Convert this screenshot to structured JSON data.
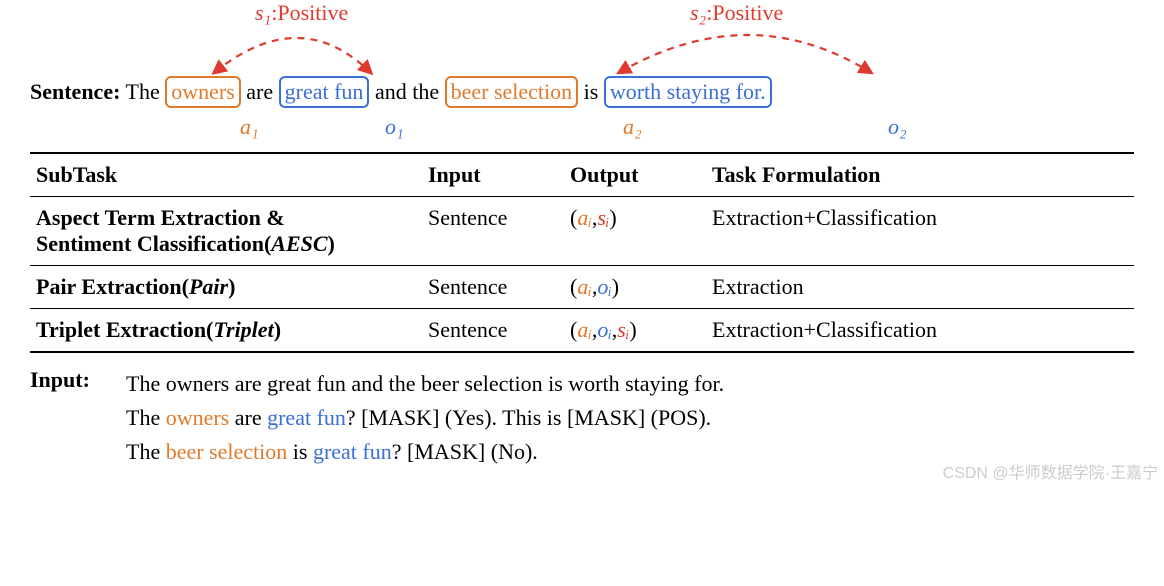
{
  "arc_labels": {
    "s1": "s₁",
    "s2": "s₂",
    "positive": ":Positive"
  },
  "sentence": {
    "label": "Sentence:",
    "w_the1": "The",
    "owners": "owners",
    "w_are": "are",
    "great_fun": "great fun",
    "w_and_the": "and the",
    "beer_selection": "beer selection",
    "w_is": "is",
    "worth_staying": "worth staying for.",
    "a1": "a₁",
    "o1": "o₁",
    "a2": "a₂",
    "o2": "o₂"
  },
  "table": {
    "headers": {
      "subtask": "SubTask",
      "input": "Input",
      "output": "Output",
      "formulation": "Task Formulation"
    },
    "rows": [
      {
        "subtask_prefix": "Aspect Term Extraction &",
        "subtask_break": " Sentiment Classification(",
        "subtask_em": "AESC",
        "subtask_suffix": ")",
        "input": "Sentence",
        "output_a": "aᵢ",
        "output_o": "",
        "output_s": "sᵢ",
        "formulation": "Extraction+Classification"
      },
      {
        "subtask_prefix": "Pair Extraction(",
        "subtask_break": "",
        "subtask_em": "Pair",
        "subtask_suffix": ")",
        "input": "Sentence",
        "output_a": "aᵢ",
        "output_o": "oᵢ",
        "output_s": "",
        "formulation": "Extraction"
      },
      {
        "subtask_prefix": "Triplet Extraction(",
        "subtask_break": "",
        "subtask_em": "Triplet",
        "subtask_suffix": ")",
        "input": "Sentence",
        "output_a": "aᵢ",
        "output_o": "oᵢ",
        "output_s": "sᵢ",
        "formulation": "Extraction+Classification"
      }
    ]
  },
  "input_block": {
    "label": "Input:",
    "line1": "The owners are great fun and the beer selection is worth staying for.",
    "l2_a": "The ",
    "l2_owners": "owners",
    "l2_b": " are ",
    "l2_greatfun": "great fun",
    "l2_c": "? [MASK] (Yes). This is [MASK] (POS).",
    "l3_a": "The ",
    "l3_beer": "beer selection",
    "l3_b": " is ",
    "l3_greatfun": "great fun",
    "l3_c": "? [MASK] (No)."
  },
  "watermark": "CSDN @华师数据学院·王嘉宁"
}
